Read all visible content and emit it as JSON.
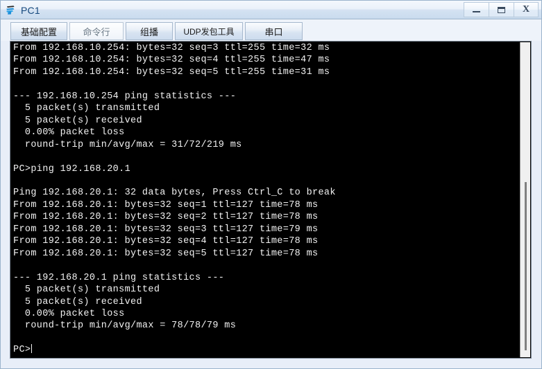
{
  "window": {
    "title": "PC1",
    "icon": "pc-device-icon",
    "controls": [
      {
        "name": "minimize-button",
        "label": "—",
        "icon": "minimize-icon"
      },
      {
        "name": "maximize-button",
        "label": "❐",
        "icon": "maximize-icon"
      },
      {
        "name": "close-button",
        "label": "X",
        "icon": "close-icon"
      }
    ]
  },
  "tabs": [
    {
      "label": "基础配置",
      "active": false
    },
    {
      "label": "命令行",
      "active": true
    },
    {
      "label": "组播",
      "active": false
    },
    {
      "label": "UDP发包工具",
      "active": false
    },
    {
      "label": "串口",
      "active": false
    }
  ],
  "terminal": {
    "prompt": "PC>",
    "background": "#000000",
    "foreground": "#f2f2f2",
    "content": "From 192.168.10.254: bytes=32 seq=3 ttl=255 time=32 ms\nFrom 192.168.10.254: bytes=32 seq=4 ttl=255 time=47 ms\nFrom 192.168.10.254: bytes=32 seq=5 ttl=255 time=31 ms\n\n--- 192.168.10.254 ping statistics ---\n  5 packet(s) transmitted\n  5 packet(s) received\n  0.00% packet loss\n  round-trip min/avg/max = 31/72/219 ms\n\nPC>ping 192.168.20.1\n\nPing 192.168.20.1: 32 data bytes, Press Ctrl_C to break\nFrom 192.168.20.1: bytes=32 seq=1 ttl=127 time=78 ms\nFrom 192.168.20.1: bytes=32 seq=2 ttl=127 time=78 ms\nFrom 192.168.20.1: bytes=32 seq=3 ttl=127 time=79 ms\nFrom 192.168.20.1: bytes=32 seq=4 ttl=127 time=78 ms\nFrom 192.168.20.1: bytes=32 seq=5 ttl=127 time=78 ms\n\n--- 192.168.20.1 ping statistics ---\n  5 packet(s) transmitted\n  5 packet(s) received\n  0.00% packet loss\n  round-trip min/avg/max = 78/78/79 ms\n\n"
  },
  "scrollbar": {
    "name": "vertical-scrollbar",
    "thumb_top_pct": 44,
    "thumb_height_pct": 53
  }
}
